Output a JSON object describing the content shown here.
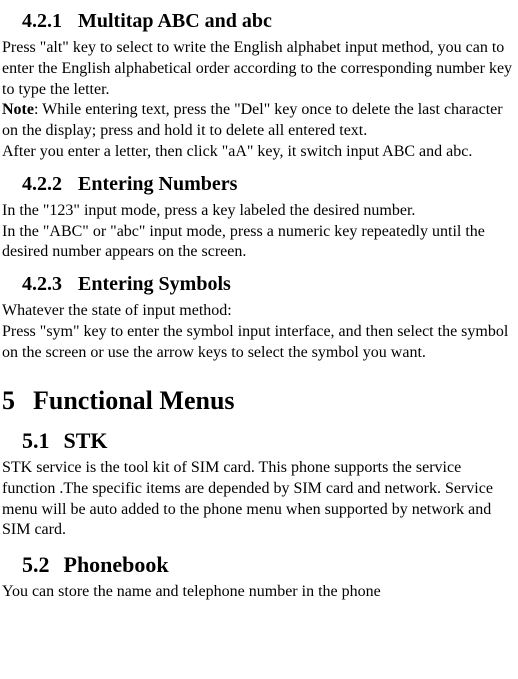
{
  "s421": {
    "num": "4.2.1",
    "title": "Multitap ABC and abc",
    "p1": "Press \"alt\" key to select to write the English alphabet input method, you can to enter the English alphabetical order according to the corresponding number key to type the letter.",
    "note_label": "Note",
    "note_body": ": While entering text, press the \"Del\" key once to delete the last character on the display; press and hold it to delete all entered text.",
    "p2": "After you enter a letter, then click \"aA\" key, it switch input ABC and abc."
  },
  "s422": {
    "num": "4.2.2",
    "title": "Entering Numbers",
    "p1": "In the \"123\" input mode, press a key labeled the desired number.",
    "p2": "In the \"ABC\" or \"abc\" input mode, press a numeric key repeatedly until the desired number appears on the screen."
  },
  "s423": {
    "num": "4.2.3",
    "title": "Entering Symbols",
    "p1": "Whatever the state of input method:",
    "p2": "Press \"sym\" key to enter the symbol input interface, and then select the symbol on the screen or use the arrow keys to select the symbol you want."
  },
  "s5": {
    "num": "5",
    "title": "Functional Menus"
  },
  "s51": {
    "num": "5.1",
    "title": "STK",
    "p1": "STK service is the tool kit of SIM card. This phone supports the service function .The specific items are depended by SIM card and network. Service menu will be auto added to the phone menu when supported by network and SIM card."
  },
  "s52": {
    "num": "5.2",
    "title": "Phonebook",
    "p1": "You can store the name and telephone number in the phone"
  }
}
